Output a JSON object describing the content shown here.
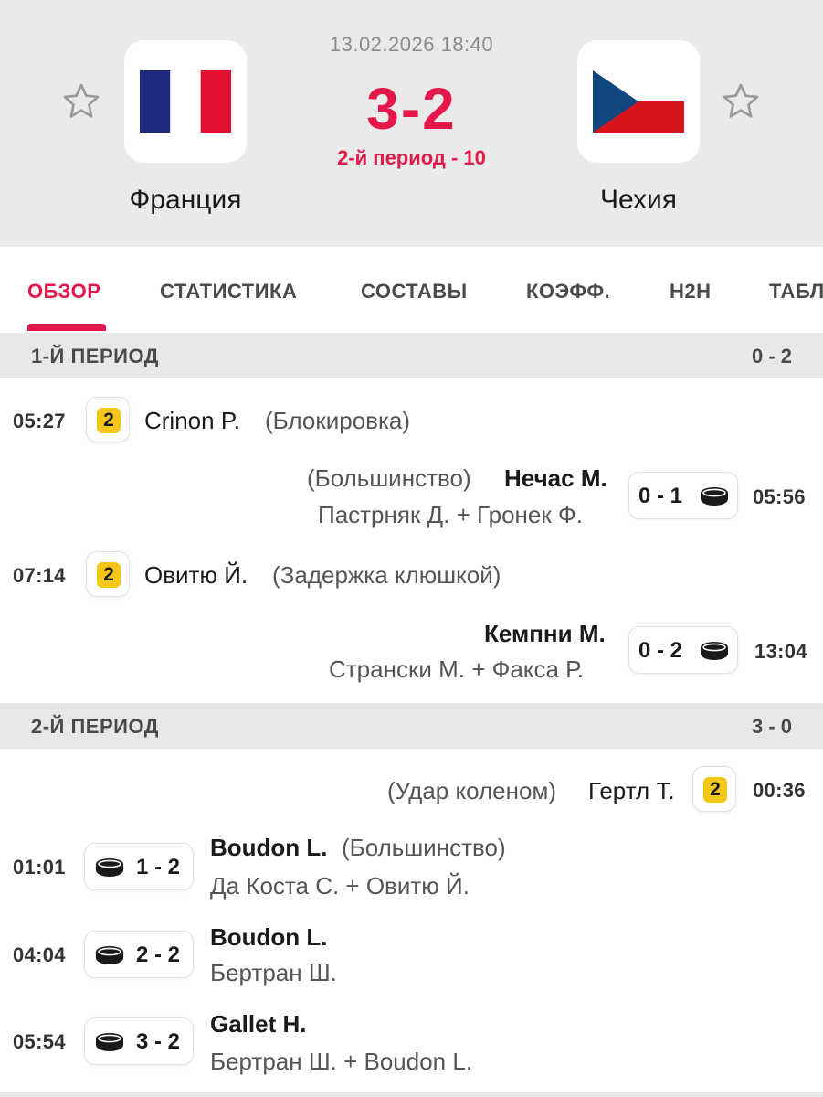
{
  "header": {
    "datetime": "13.02.2026 18:40",
    "score": "3-2",
    "status": "2-й период - 10",
    "home": {
      "name": "Франция"
    },
    "away": {
      "name": "Чехия"
    }
  },
  "tabs": [
    {
      "label": "ОБЗОР",
      "active": true
    },
    {
      "label": "СТАТИСТИКА"
    },
    {
      "label": "СОСТАВЫ"
    },
    {
      "label": "КОЭФФ."
    },
    {
      "label": "H2H"
    },
    {
      "label": "ТАБЛ"
    }
  ],
  "periods": [
    {
      "title": "1-Й ПЕРИОД",
      "score": "0 - 2",
      "events": [
        {
          "type": "penalty",
          "side": "home",
          "time": "05:27",
          "minutes": "2",
          "player": "Crinon P.",
          "reason": "(Блокировка)"
        },
        {
          "type": "goal",
          "side": "away",
          "time": "05:56",
          "score": "0 - 1",
          "scorer": "Нечас М.",
          "note": "(Большинство)",
          "assists": "Пастрняк Д. + Гронек Ф."
        },
        {
          "type": "penalty",
          "side": "home",
          "time": "07:14",
          "minutes": "2",
          "player": "Овитю Й.",
          "reason": "(Задержка клюшкой)"
        },
        {
          "type": "goal",
          "side": "away",
          "time": "13:04",
          "score": "0 - 2",
          "scorer": "Кемпни М.",
          "note": "",
          "assists": "Странски М. + Факса Р."
        }
      ]
    },
    {
      "title": "2-Й ПЕРИОД",
      "score": "3 - 0",
      "events": [
        {
          "type": "penalty",
          "side": "away",
          "time": "00:36",
          "minutes": "2",
          "player": "Гертл Т.",
          "reason": "(Удар коленом)"
        },
        {
          "type": "goal",
          "side": "home",
          "time": "01:01",
          "score": "1 - 2",
          "scorer": "Boudon L.",
          "note": "(Большинство)",
          "assists": "Да Коста С. + Овитю Й."
        },
        {
          "type": "goal",
          "side": "home",
          "time": "04:04",
          "score": "2 - 2",
          "scorer": "Boudon L.",
          "note": "",
          "assists": "Бертран Ш."
        },
        {
          "type": "goal",
          "side": "home",
          "time": "05:54",
          "score": "3 - 2",
          "scorer": "Gallet H.",
          "note": "",
          "assists": "Бертран Ш. + Boudon L."
        }
      ]
    }
  ],
  "colors": {
    "accent": "#e4184a",
    "penalty": "#f5c518",
    "header_bg": "#eaeaea",
    "period_bg": "#e8e8e8"
  },
  "icons": {
    "favorite": "star-outline-icon",
    "goal": "hockey-puck-icon",
    "penalty": "penalty-card-icon"
  }
}
